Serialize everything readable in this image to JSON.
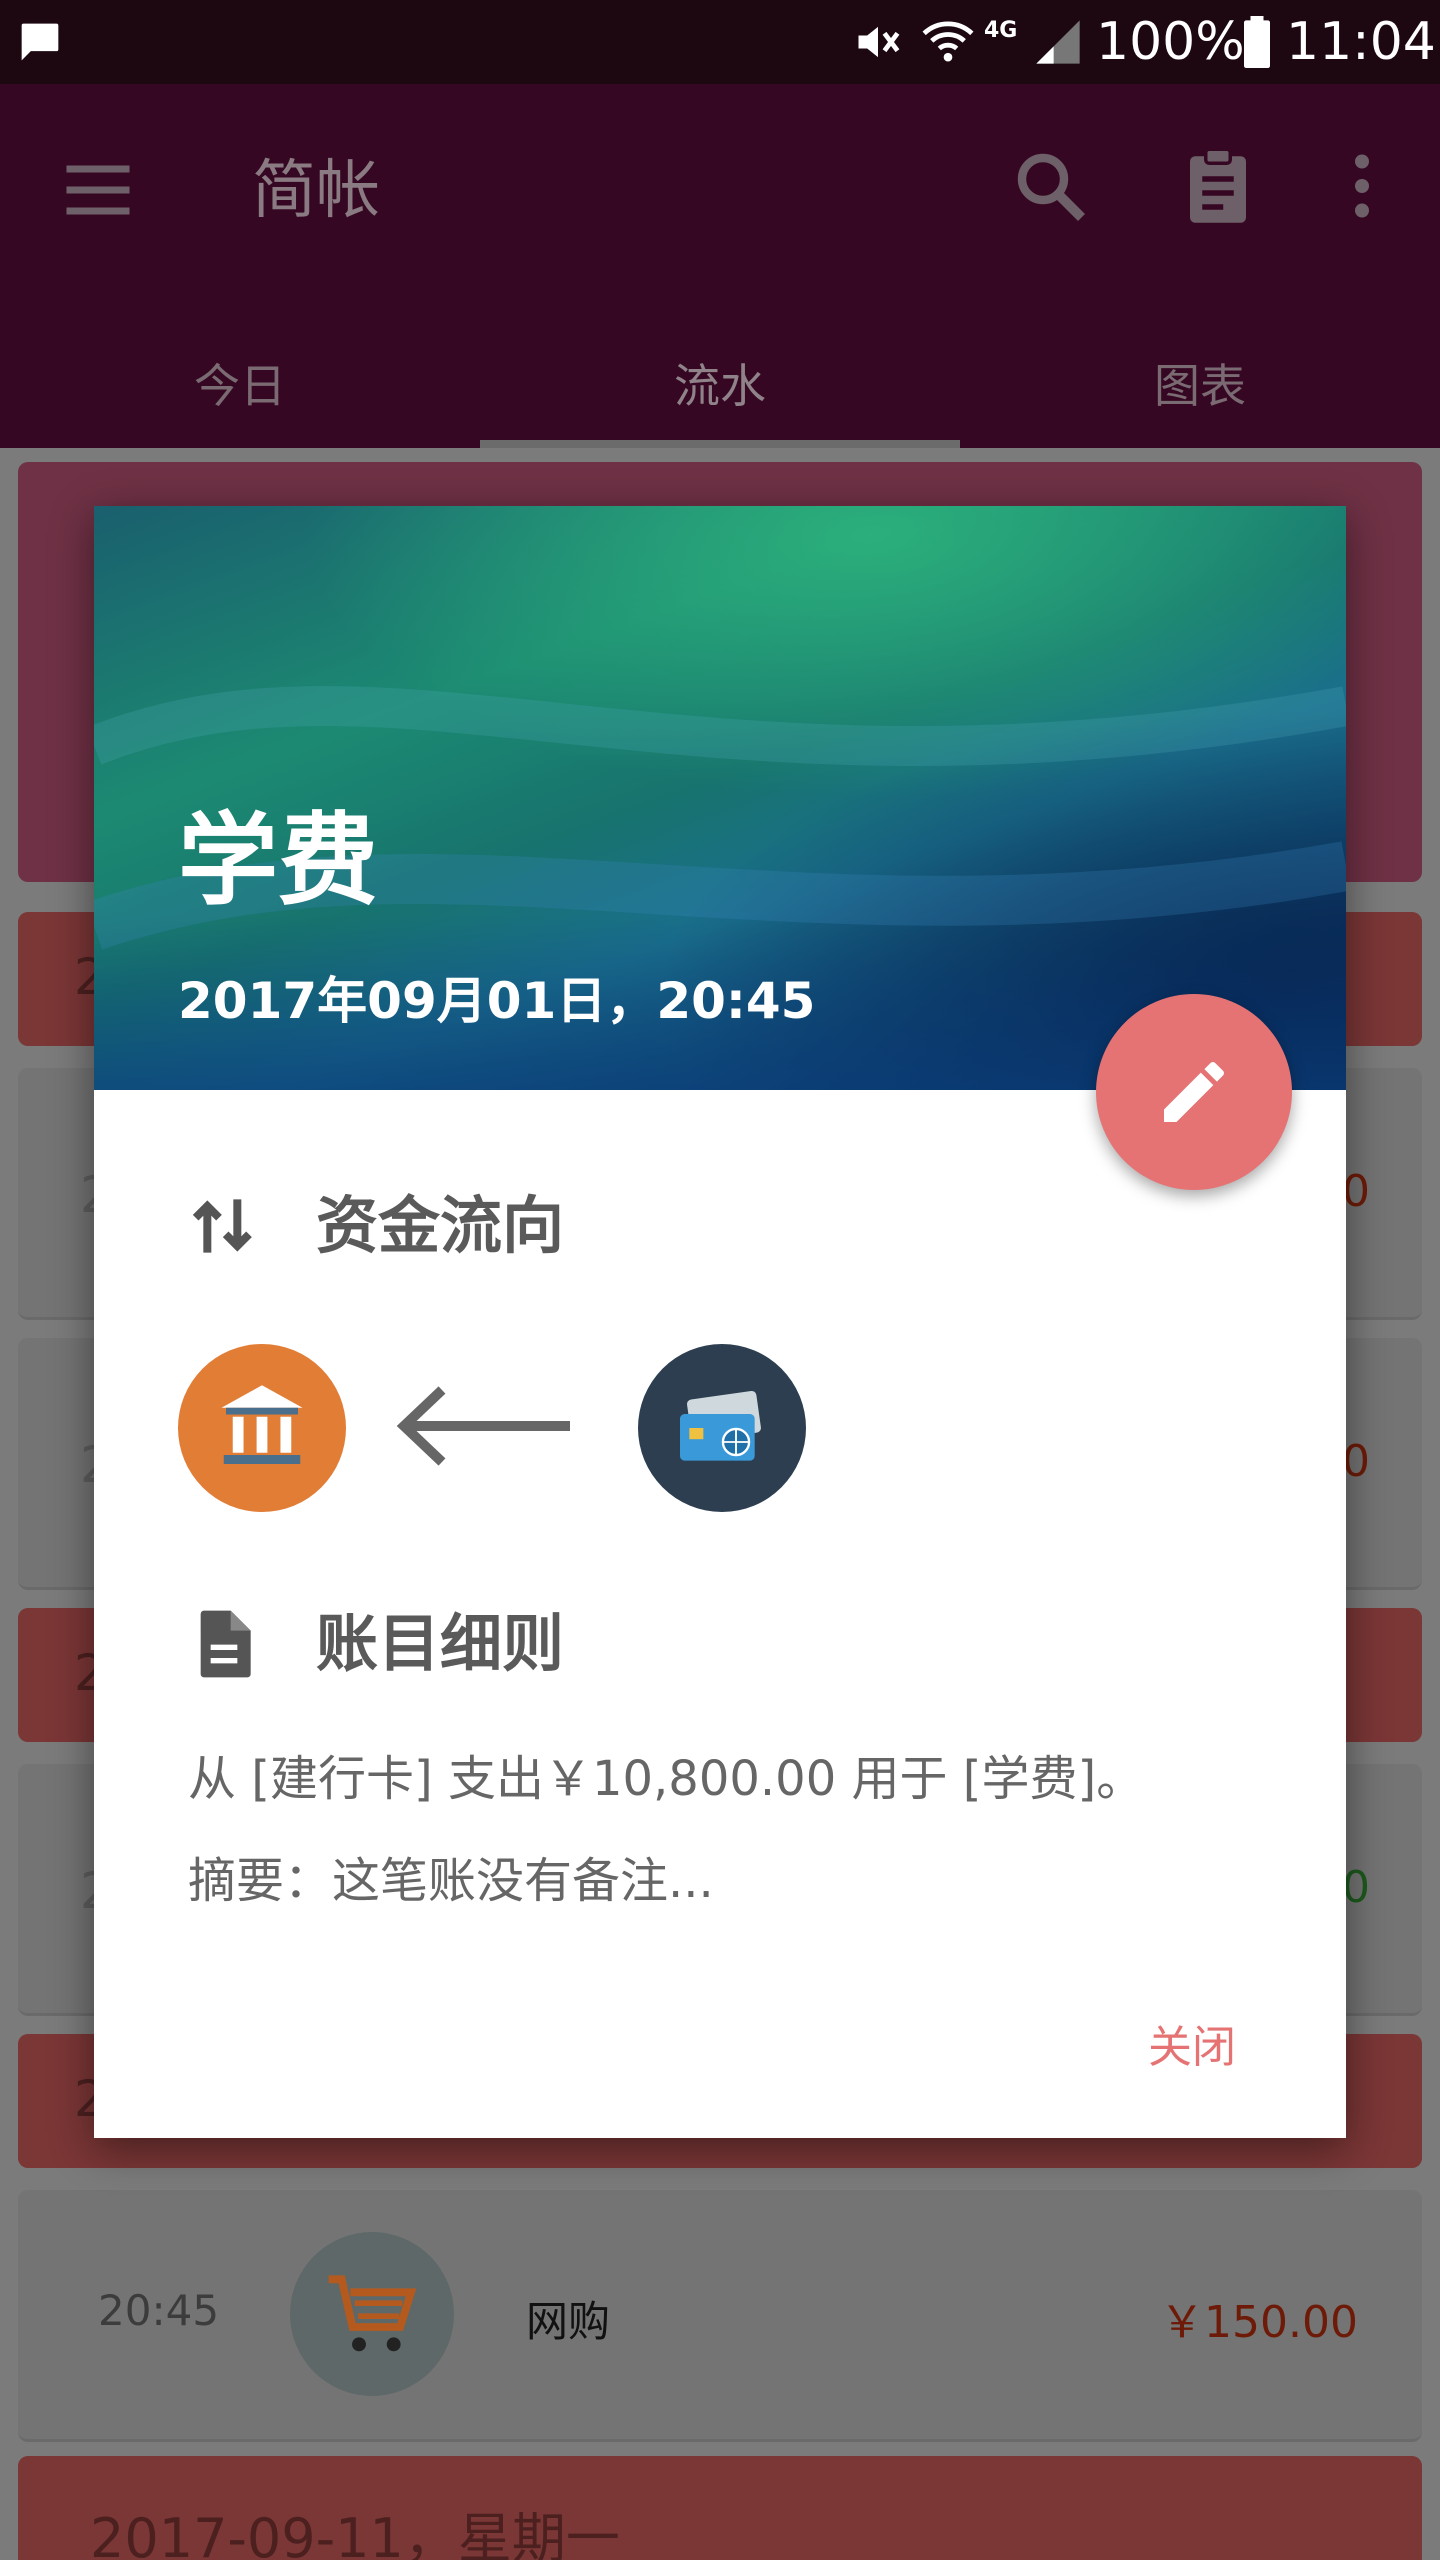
{
  "status_bar": {
    "battery_percent": "100%",
    "time": "11:04",
    "network": "4G",
    "icons": [
      "message-icon",
      "mute-icon",
      "wifi-icon",
      "signal-icon",
      "battery-icon"
    ]
  },
  "app_bar": {
    "title": "简帐",
    "icons": [
      "menu-icon",
      "search-icon",
      "clipboard-icon",
      "more-vert-icon"
    ],
    "tabs": [
      {
        "label": "今日",
        "active": false
      },
      {
        "label": "流水",
        "active": true
      },
      {
        "label": "图表",
        "active": false
      }
    ]
  },
  "background_list": {
    "peek_prefix": "2",
    "amount_suffix": "0",
    "row": {
      "time": "20:45",
      "category_icon": "shopping-cart-icon",
      "name": "网购",
      "amount": "￥150.00"
    },
    "date_header": "2017-09-11，星期一"
  },
  "dialog": {
    "title": "学费",
    "datetime": "2017年09月01日，20:45",
    "edit_icon": "pencil-icon",
    "flow_section": {
      "icon": "swap-vert-icon",
      "title": "资金流向",
      "to_icon": "bank-icon",
      "arrow_icon": "arrow-left-icon",
      "from_icon": "credit-card-icon"
    },
    "detail_section": {
      "icon": "document-icon",
      "title": "账目细则",
      "line1": "从 [建行卡] 支出￥10,800.00 用于 [学费]。",
      "line2": "摘要：这笔账没有备注..."
    },
    "close_label": "关闭"
  },
  "colors": {
    "status_bar": "#1d0812",
    "app_bar": "#360723",
    "accent": "#e57373",
    "bank_circle": "#e27d35",
    "card_circle": "#2c3e50"
  }
}
